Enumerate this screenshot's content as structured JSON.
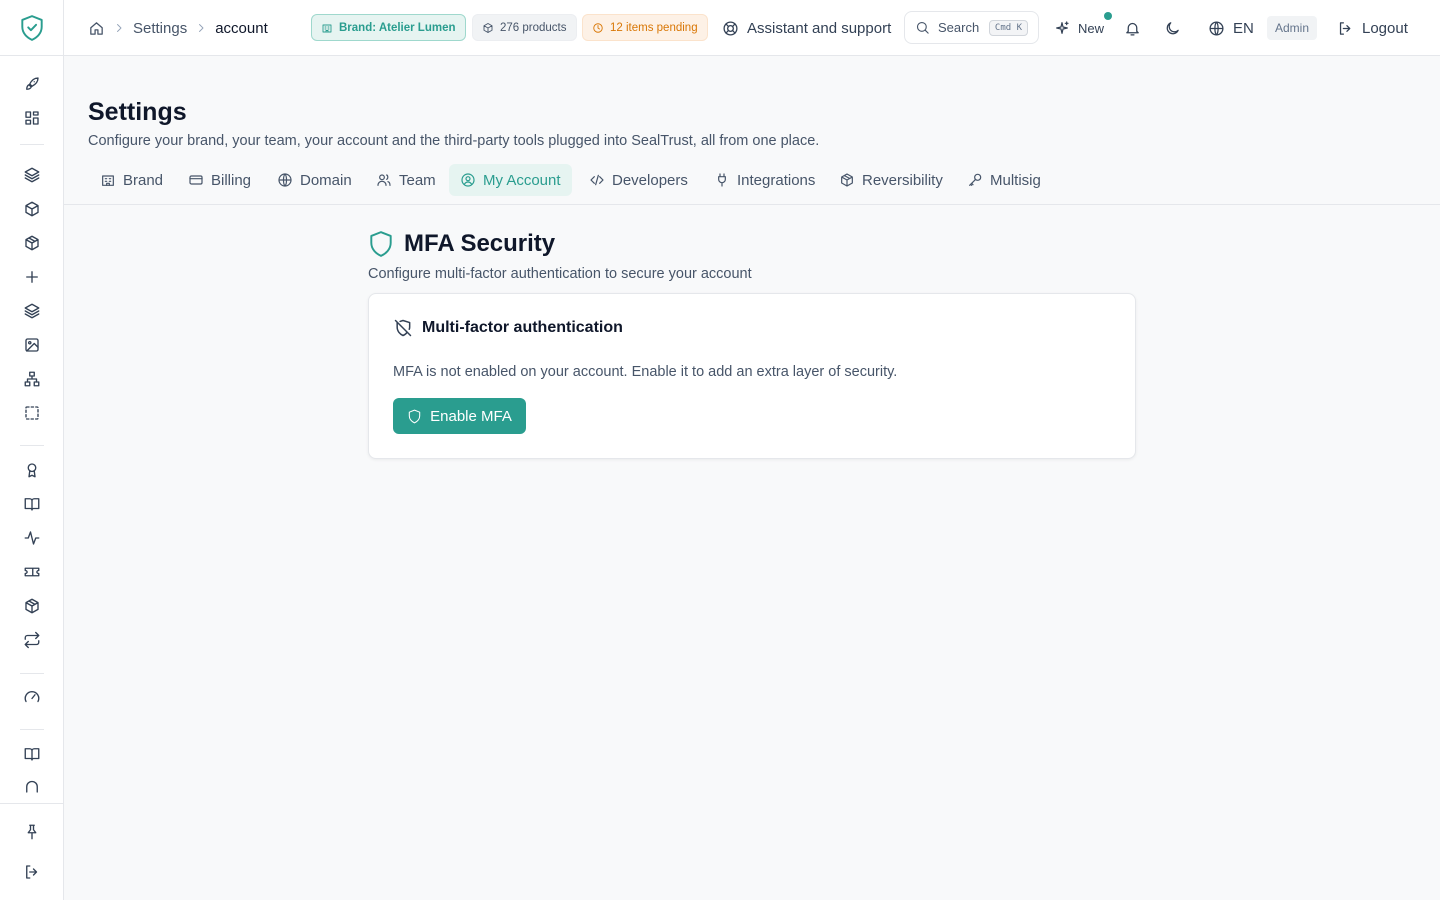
{
  "app": {
    "name": "SealTrust",
    "accent_color": "#2a9d8f"
  },
  "sidebar": {
    "logo_icon": "shield-check-icon",
    "items": [
      {
        "icon": "rocket-icon"
      },
      {
        "icon": "dashboard-grid-icon"
      },
      {
        "icon": "layers-icon"
      },
      {
        "icon": "box-icon"
      },
      {
        "icon": "box-open-icon"
      },
      {
        "icon": "plus-icon"
      },
      {
        "icon": "layers-stack-icon"
      },
      {
        "icon": "image-icon"
      },
      {
        "icon": "network-icon"
      },
      {
        "icon": "selection-icon"
      },
      {
        "icon": "award-icon"
      },
      {
        "icon": "book-open-icon"
      },
      {
        "icon": "activity-icon"
      },
      {
        "icon": "ticket-icon"
      },
      {
        "icon": "package-icon"
      },
      {
        "icon": "repeat-icon"
      },
      {
        "icon": "gauge-icon"
      },
      {
        "icon": "book-icon"
      },
      {
        "icon": "headset-icon"
      },
      {
        "icon": "pin-icon"
      },
      {
        "icon": "sign-out-icon"
      }
    ]
  },
  "header": {
    "breadcrumb": {
      "root": "Settings",
      "current": "account"
    },
    "badges": {
      "brand": "Brand: Atelier Lumen",
      "products": "276 products",
      "pending": "12 items pending"
    },
    "assistant_label": "Assistant and support",
    "search": {
      "label": "Search",
      "shortcut": "Cmd K"
    },
    "new_label": "New",
    "language": "EN",
    "role": "Admin",
    "logout_label": "Logout"
  },
  "page": {
    "title": "Settings",
    "description": "Configure your brand, your team, your account and the third-party tools plugged into SealTrust, all from one place."
  },
  "tabs": [
    {
      "label": "Brand",
      "icon": "building-icon",
      "active": false
    },
    {
      "label": "Billing",
      "icon": "credit-card-icon",
      "active": false
    },
    {
      "label": "Domain",
      "icon": "globe-icon",
      "active": false
    },
    {
      "label": "Team",
      "icon": "users-icon",
      "active": false
    },
    {
      "label": "My Account",
      "icon": "user-circle-icon",
      "active": true
    },
    {
      "label": "Developers",
      "icon": "code-icon",
      "active": false
    },
    {
      "label": "Integrations",
      "icon": "plug-icon",
      "active": false
    },
    {
      "label": "Reversibility",
      "icon": "package-icon",
      "active": false
    },
    {
      "label": "Multisig",
      "icon": "key-icon",
      "active": false
    }
  ],
  "section": {
    "title": "MFA Security",
    "description": "Configure multi-factor authentication to secure your account",
    "card": {
      "title": "Multi-factor authentication",
      "text": "MFA is not enabled on your account. Enable it to add an extra layer of security.",
      "button_label": "Enable MFA"
    }
  }
}
